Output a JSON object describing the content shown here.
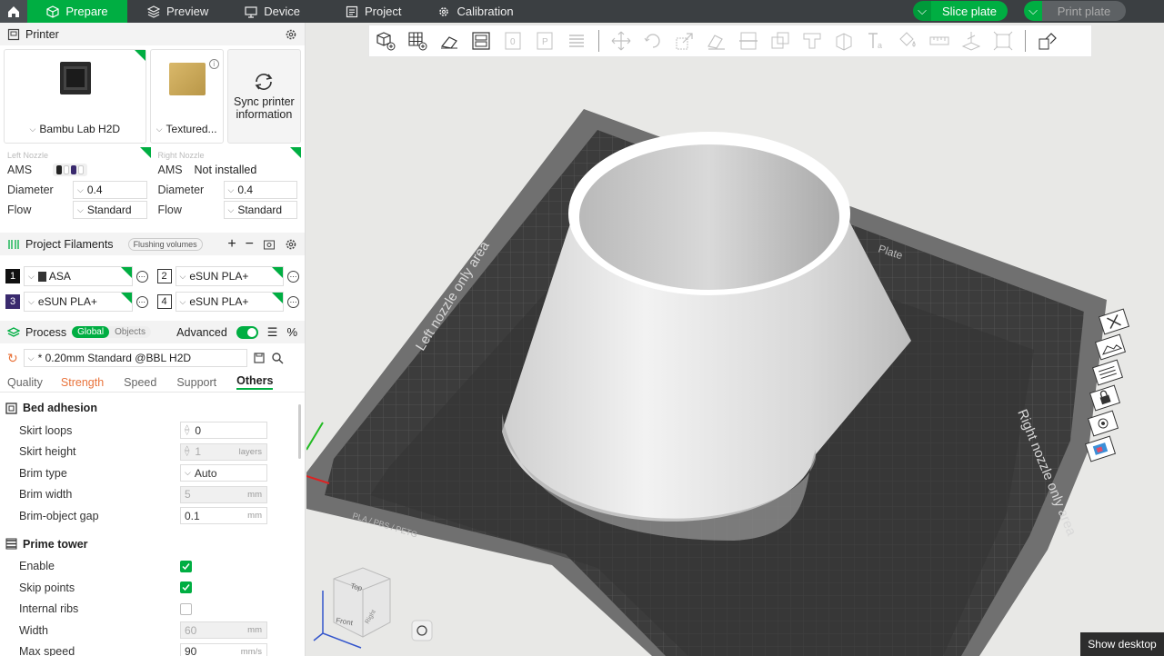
{
  "topbar": {
    "tabs": [
      "Prepare",
      "Preview",
      "Device",
      "Project",
      "Calibration"
    ],
    "slice_label": "Slice plate",
    "print_label": "Print plate"
  },
  "printer": {
    "section_title": "Printer",
    "model": "Bambu Lab H2D",
    "plate": "Textured...",
    "sync_label": "Sync printer information"
  },
  "nozzles": {
    "left": {
      "caption": "Left Nozzle",
      "ams_label": "AMS",
      "diameter_label": "Diameter",
      "diameter": "0.4",
      "flow_label": "Flow",
      "flow": "Standard"
    },
    "right": {
      "caption": "Right Nozzle",
      "ams_label": "AMS",
      "ams_value": "Not installed",
      "diameter_label": "Diameter",
      "diameter": "0.4",
      "flow_label": "Flow",
      "flow": "Standard"
    }
  },
  "filaments": {
    "section_title": "Project Filaments",
    "flushing_label": "Flushing volumes",
    "items": [
      {
        "num": "1",
        "name": "ASA",
        "color": "#111111"
      },
      {
        "num": "2",
        "name": "eSUN PLA+",
        "color": "#ffffff"
      },
      {
        "num": "3",
        "name": "eSUN PLA+",
        "color": "#3a2a6e"
      },
      {
        "num": "4",
        "name": "eSUN PLA+",
        "color": "#ffffff"
      }
    ]
  },
  "process": {
    "section_title": "Process",
    "global_label": "Global",
    "objects_label": "Objects",
    "advanced_label": "Advanced",
    "preset": "* 0.20mm Standard @BBL H2D",
    "tabs": [
      "Quality",
      "Strength",
      "Speed",
      "Support",
      "Others"
    ]
  },
  "bed_adhesion": {
    "title": "Bed adhesion",
    "skirt_loops_label": "Skirt loops",
    "skirt_loops": "0",
    "skirt_height_label": "Skirt height",
    "skirt_height": "1",
    "skirt_height_unit": "layers",
    "brim_type_label": "Brim type",
    "brim_type": "Auto",
    "brim_width_label": "Brim width",
    "brim_width": "5",
    "brim_width_unit": "mm",
    "brim_gap_label": "Brim-object gap",
    "brim_gap": "0.1",
    "brim_gap_unit": "mm"
  },
  "prime_tower": {
    "title": "Prime tower",
    "enable_label": "Enable",
    "skip_label": "Skip points",
    "ribs_label": "Internal ribs",
    "width_label": "Width",
    "width": "60",
    "width_unit": "mm",
    "speed_label": "Max speed",
    "speed": "90",
    "speed_unit": "mm/s"
  },
  "viewport": {
    "left_area": "Left nozzle only area",
    "right_area": "Right nozzle only area",
    "plate_label": "Plate",
    "plate_tag": "PLA / PBS / PETG",
    "cube_top": "Top",
    "cube_front": "Front",
    "cube_right": "Right"
  },
  "taskbar": {
    "show_desktop": "Show desktop"
  }
}
